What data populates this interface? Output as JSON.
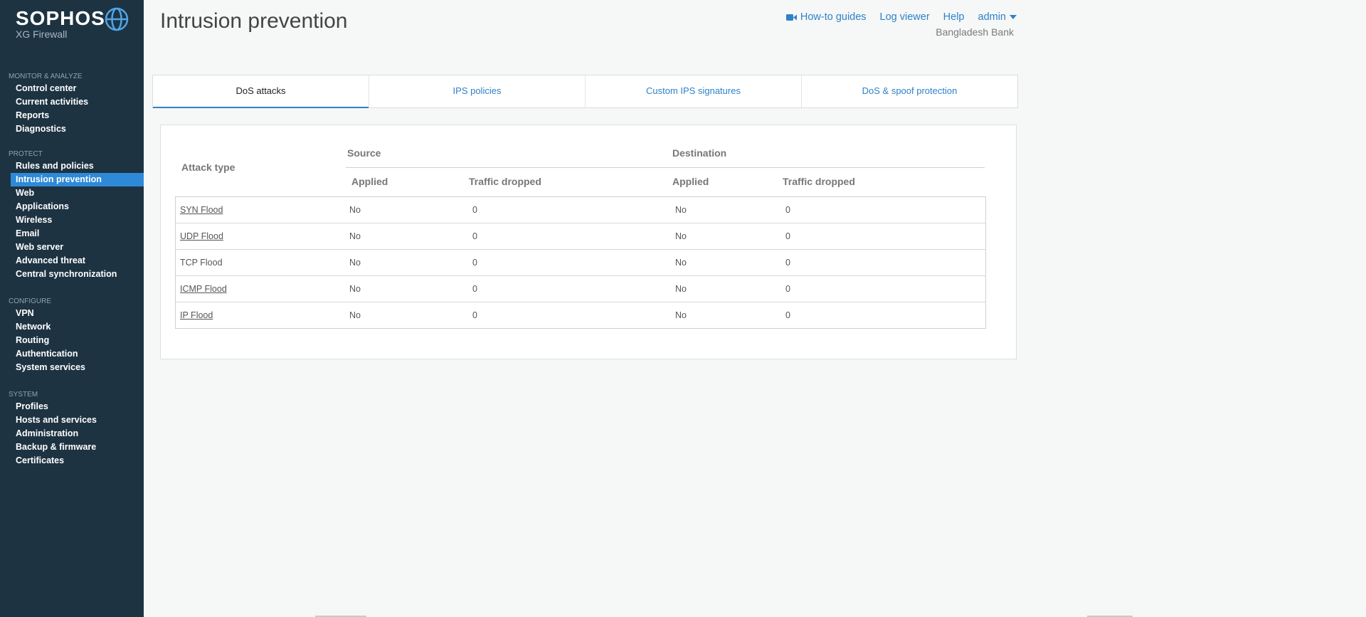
{
  "brand": {
    "name": "SOPHOS",
    "product": "XG Firewall"
  },
  "sidebar": {
    "sections": [
      {
        "header": "MONITOR & ANALYZE",
        "items": [
          "Control center",
          "Current activities",
          "Reports",
          "Diagnostics"
        ]
      },
      {
        "header": "PROTECT",
        "items": [
          "Rules and policies",
          "Intrusion prevention",
          "Web",
          "Applications",
          "Wireless",
          "Email",
          "Web server",
          "Advanced threat",
          "Central synchronization"
        ]
      },
      {
        "header": "CONFIGURE",
        "items": [
          "VPN",
          "Network",
          "Routing",
          "Authentication",
          "System services"
        ]
      },
      {
        "header": "SYSTEM",
        "items": [
          "Profiles",
          "Hosts and services",
          "Administration",
          "Backup & firmware",
          "Certificates"
        ]
      }
    ],
    "active_item": "Intrusion prevention"
  },
  "header": {
    "title": "Intrusion prevention",
    "links": {
      "guides": "How-to guides",
      "log_viewer": "Log viewer",
      "help": "Help",
      "user": "admin"
    },
    "org": "Bangladesh Bank"
  },
  "tabs": [
    "DoS attacks",
    "IPS policies",
    "Custom IPS signatures",
    "DoS & spoof protection"
  ],
  "active_tab": "DoS attacks",
  "table": {
    "attack_type_header": "Attack type",
    "source_header": "Source",
    "destination_header": "Destination",
    "applied_header": "Applied",
    "dropped_header": "Traffic dropped",
    "rows": [
      {
        "name": "SYN Flood",
        "linked": true,
        "src_applied": "No",
        "src_dropped": "0",
        "dst_applied": "No",
        "dst_dropped": "0"
      },
      {
        "name": "UDP Flood",
        "linked": true,
        "src_applied": "No",
        "src_dropped": "0",
        "dst_applied": "No",
        "dst_dropped": "0"
      },
      {
        "name": "TCP Flood",
        "linked": false,
        "src_applied": "No",
        "src_dropped": "0",
        "dst_applied": "No",
        "dst_dropped": "0"
      },
      {
        "name": "ICMP Flood",
        "linked": true,
        "src_applied": "No",
        "src_dropped": "0",
        "dst_applied": "No",
        "dst_dropped": "0"
      },
      {
        "name": "IP Flood",
        "linked": true,
        "src_applied": "No",
        "src_dropped": "0",
        "dst_applied": "No",
        "dst_dropped": "0"
      }
    ]
  },
  "colors": {
    "sidebar": "#1d3342",
    "accent": "#2e82c9",
    "active_item": "#2e8ad8"
  },
  "icons": {
    "logo": "globe-icon",
    "guides": "video-camera-icon",
    "user_menu": "caret-down-icon"
  }
}
